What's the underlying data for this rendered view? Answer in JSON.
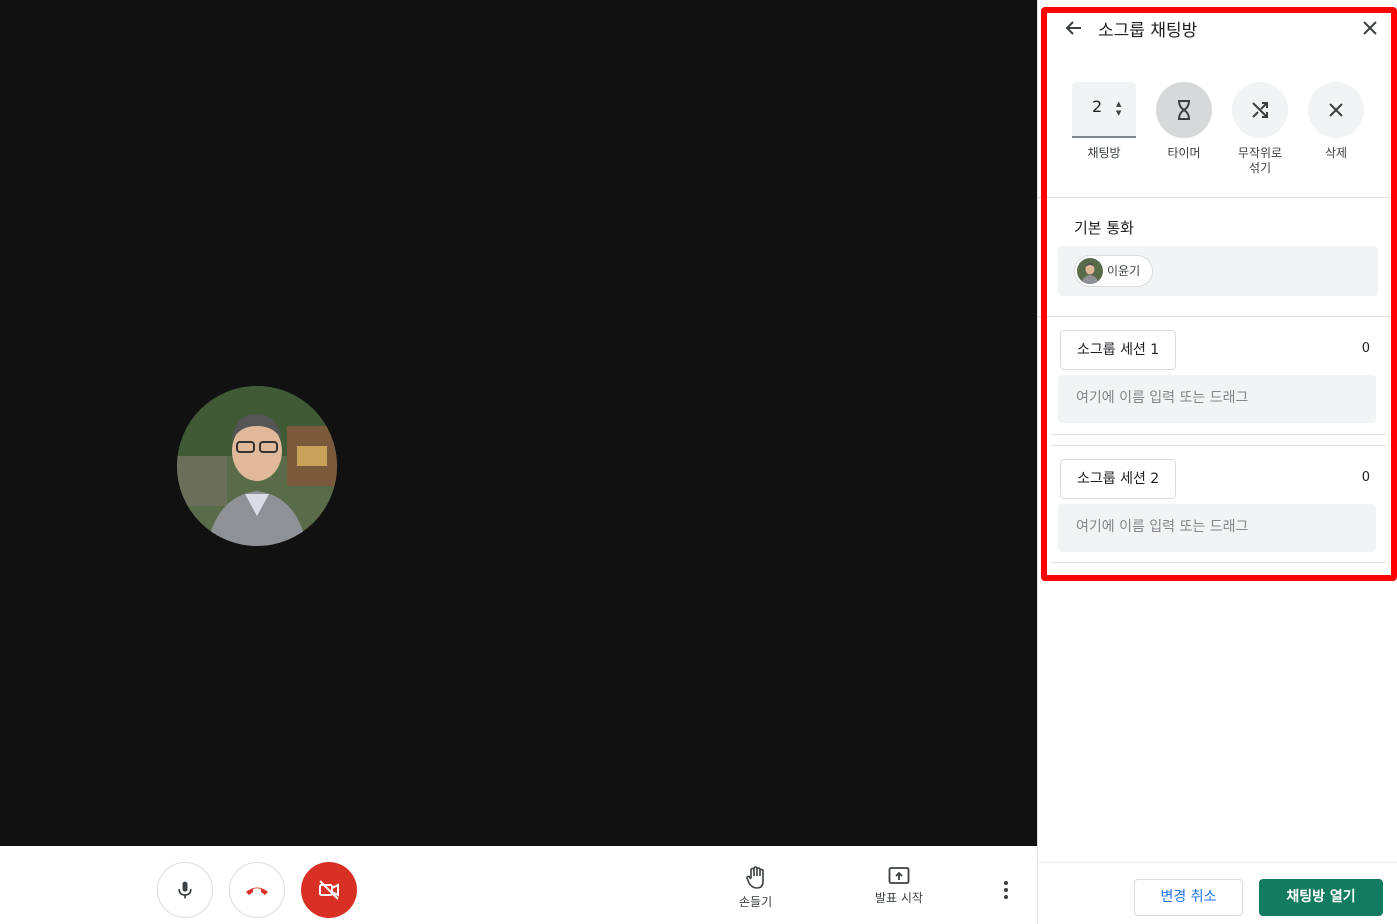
{
  "bottom_bar": {
    "raise_hand_label": "손들기",
    "present_label": "발표 시작"
  },
  "panel": {
    "title": "소그룹 채팅방",
    "tools": {
      "room_count": "2",
      "room_count_label": "채팅방",
      "timer_label": "타이머",
      "shuffle_label_line1": "무작위로",
      "shuffle_label_line2": "섞기",
      "delete_label": "삭제"
    },
    "main_call": {
      "label": "기본 통화",
      "participant": "이윤기"
    },
    "sessions": [
      {
        "name": "소그룹 세션 1",
        "count": "0",
        "placeholder": "여기에 이름 입력 또는 드래그"
      },
      {
        "name": "소그룹 세션 2",
        "count": "0",
        "placeholder": "여기에 이름 입력 또는 드래그"
      }
    ],
    "footer": {
      "cancel_label": "변경 취소",
      "open_label": "채팅방 열기"
    }
  },
  "colors": {
    "stage_bg": "#111111",
    "end_call_red": "#d93025",
    "primary_green": "#137b5f",
    "highlight_red": "#ff0000"
  }
}
